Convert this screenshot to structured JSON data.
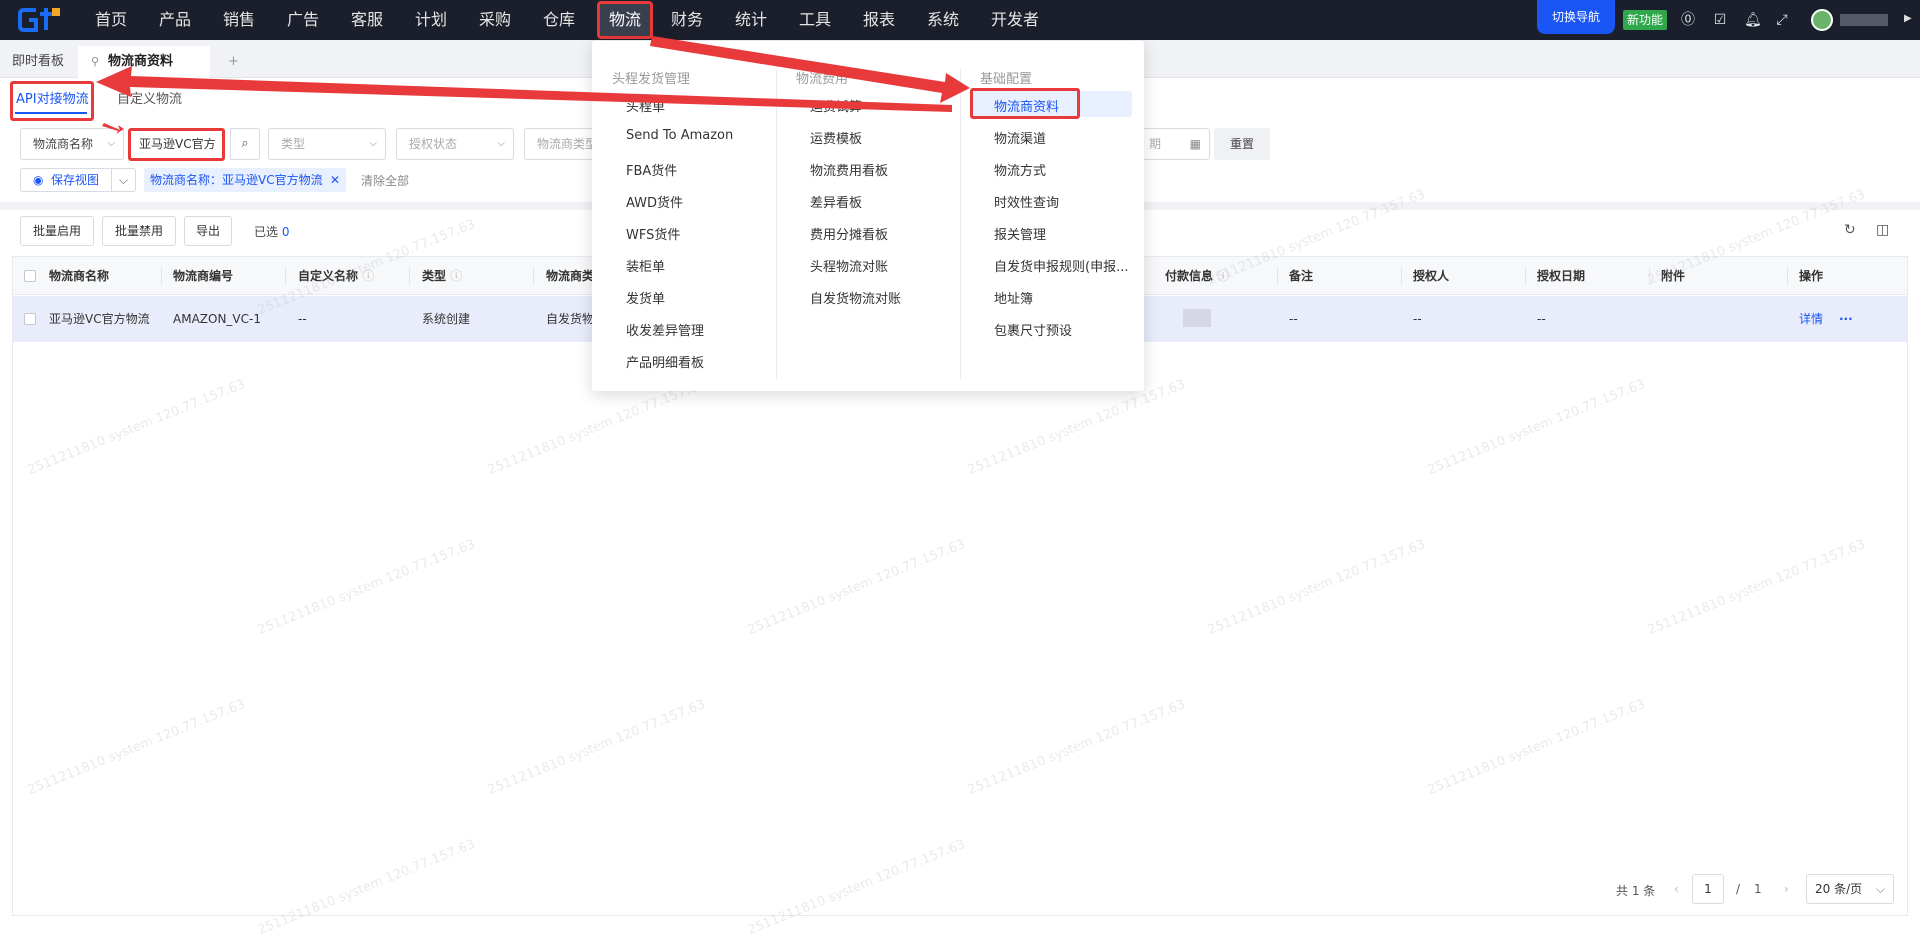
{
  "nav": {
    "items": [
      "首页",
      "产品",
      "销售",
      "广告",
      "客服",
      "计划",
      "采购",
      "仓库",
      "物流",
      "财务",
      "统计",
      "工具",
      "报表",
      "系统",
      "开发者"
    ],
    "active": "物流",
    "switch_nav": "切换导航",
    "new_feature": "新功能"
  },
  "tabs": {
    "dashboard": "即时看板",
    "current": "物流商资料",
    "add": "+"
  },
  "subtabs": {
    "api": "API对接物流",
    "custom": "自定义物流"
  },
  "filters": {
    "provider_name_select": "物流商名称",
    "provider_name_value": "亚马逊VC官方",
    "type_placeholder": "类型",
    "auth_status_placeholder": "授权状态",
    "provider_type_placeholder": "物流商类型",
    "date_placeholder": "期",
    "reset": "重置"
  },
  "view": {
    "save_view": "保存视图",
    "chip": "物流商名称：亚马逊VC官方物流",
    "clear_all": "清除全部"
  },
  "actions": {
    "batch_enable": "批量启用",
    "batch_disable": "批量禁用",
    "export": "导出",
    "selected_label": "已选",
    "selected_count": "0"
  },
  "table": {
    "columns": [
      "物流商名称",
      "物流商编号",
      "自定义名称",
      "类型",
      "物流商类",
      "付款信息",
      "备注",
      "授权人",
      "授权日期",
      "附件",
      "操作"
    ],
    "rows": [
      {
        "name": "亚马逊VC官方物流",
        "code": "AMAZON_VC-1",
        "custom_name": "--",
        "type": "系统创建",
        "provider_type": "自发货物",
        "remark": "--",
        "authorizer": "--",
        "auth_date": "--",
        "detail": "详情",
        "more": "···"
      }
    ]
  },
  "pager": {
    "total": "共 1 条",
    "prev": "‹",
    "page": "1",
    "slash": "/",
    "pages": "1",
    "next": "›",
    "size": "20 条/页"
  },
  "menu": {
    "col1_title": "头程发货管理",
    "col1": [
      "头程单",
      "Send To Amazon",
      "FBA货件",
      "AWD货件",
      "WFS货件",
      "装柜单",
      "发货单",
      "收发差异管理",
      "产品明细看板"
    ],
    "col2_title": "物流费用",
    "col2": [
      "运费试算",
      "运费模板",
      "物流费用看板",
      "差异看板",
      "费用分摊看板",
      "头程物流对账",
      "自发货物流对账"
    ],
    "col3_title": "基础配置",
    "col3": [
      "物流商资料",
      "物流渠道",
      "物流方式",
      "时效性查询",
      "报关管理",
      "自发货申报规则(申报...",
      "地址簿",
      "包裹尺寸预设"
    ]
  },
  "watermark": "2511211810 system 120.77.157.63",
  "colors": {
    "accent": "#1a55f6",
    "highlight": "#e8393b",
    "nav_bg": "#1b1f2b",
    "new_feature": "#2ea84a"
  }
}
